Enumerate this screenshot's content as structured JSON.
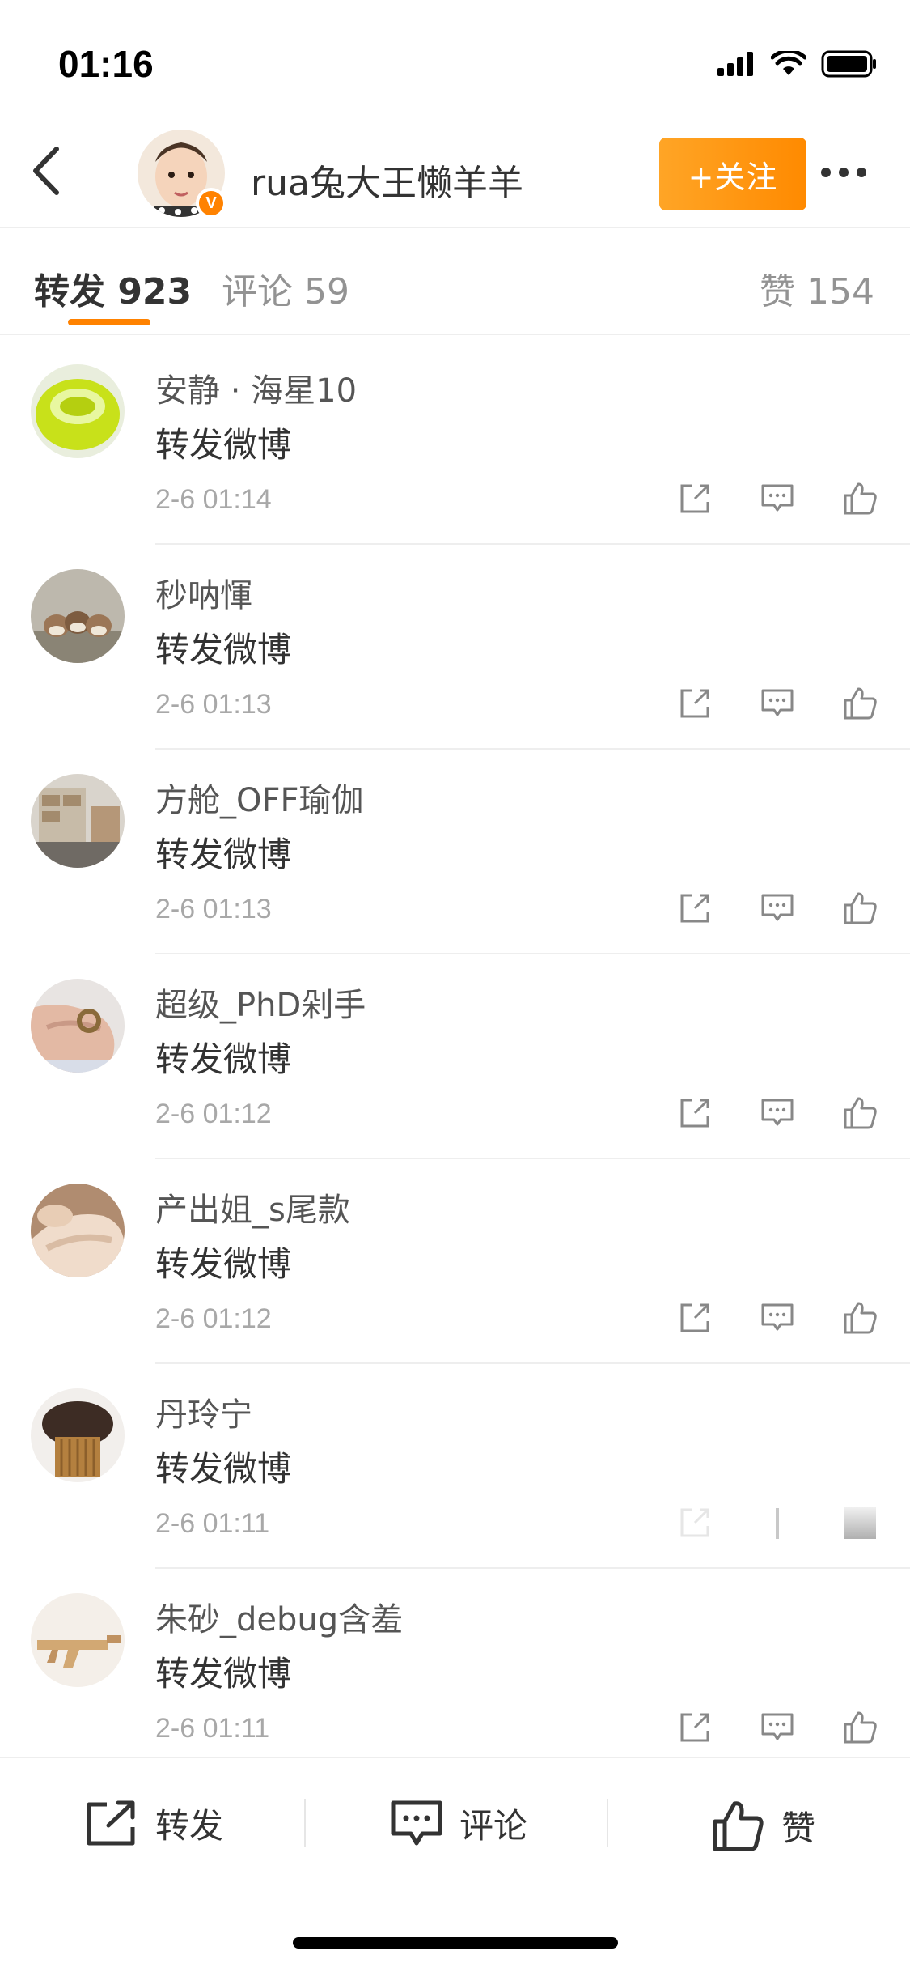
{
  "status_bar": {
    "time": "01:16"
  },
  "nav": {
    "username": "rua兔大王懒羊羊",
    "follow_label": "+关注",
    "verified_badge": "V"
  },
  "tabs": [
    {
      "label": "转发 923",
      "active": true
    },
    {
      "label": "评论 59",
      "active": false
    },
    {
      "label": "赞 154",
      "active": false
    }
  ],
  "reposts": [
    {
      "name": "安静 · 海星10",
      "content": "转发微博",
      "time": "2-6 01:14",
      "avatar": "green-object"
    },
    {
      "name": "秒呐惲",
      "content": "转发微博",
      "time": "2-6 01:13",
      "avatar": "birds"
    },
    {
      "name": "方舱_OFF瑜伽",
      "content": "转发微博",
      "time": "2-6 01:13",
      "avatar": "room"
    },
    {
      "name": "超级_PhD剁手",
      "content": "转发微博",
      "time": "2-6 01:12",
      "avatar": "hand-ring"
    },
    {
      "name": "产出姐_s尾款",
      "content": "转发微博",
      "time": "2-6 01:12",
      "avatar": "hands"
    },
    {
      "name": "丹玲宁",
      "content": "转发微博",
      "time": "2-6 01:11",
      "avatar": "mushroom"
    },
    {
      "name": "朱砂_debug含羞",
      "content": "转发微博",
      "time": "2-6 01:11",
      "avatar": "wooden-gun"
    }
  ],
  "bottom_bar": {
    "repost_label": "转发",
    "comment_label": "评论",
    "like_label": "赞"
  },
  "colors": {
    "accent": "#ff8200",
    "follow_gradient_start": "#ffa526",
    "follow_gradient_end": "#ff8a00",
    "divider": "#eeeeee",
    "secondary_text": "#939393"
  },
  "icons": {
    "back": "chevron-left-icon",
    "more": "more-dots-icon",
    "repost": "share-arrow-icon",
    "comment": "comment-bubble-icon",
    "like": "thumbs-up-icon",
    "signal": "signal-icon",
    "wifi": "wifi-icon",
    "battery": "battery-icon"
  }
}
